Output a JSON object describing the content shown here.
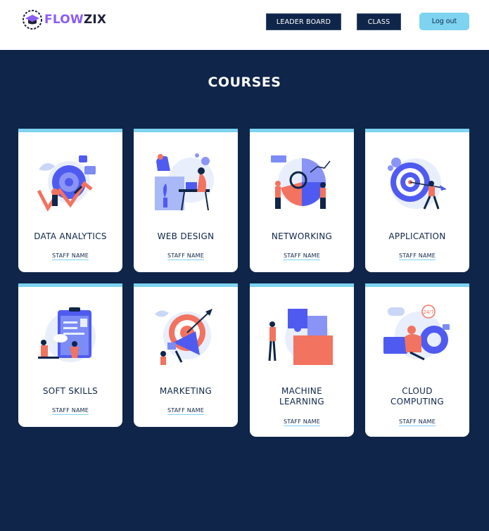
{
  "header": {
    "logo_part1": "FLOW",
    "logo_part2": "ZIX",
    "leaderboard_label": "LEADER BOARD",
    "class_label": "CLASS",
    "logout_label": "Log out"
  },
  "main": {
    "title": "COURSES",
    "courses": [
      {
        "name": "DATA ANALYTICS",
        "staff": "STAFF NAME"
      },
      {
        "name": "WEB DESIGN",
        "staff": "STAFF NAME"
      },
      {
        "name": "NETWORKING",
        "staff": "STAFF NAME"
      },
      {
        "name": "APPLICATION",
        "staff": "STAFF NAME"
      },
      {
        "name": "SOFT SKILLS",
        "staff": "STAFF NAME"
      },
      {
        "name": "MARKETING",
        "staff": "STAFF NAME"
      },
      {
        "name": "MACHINE\nLEARNING",
        "staff": "STAFF NAME"
      },
      {
        "name": "CLOUD\nCOMPUTING",
        "staff": "STAFF NAME"
      }
    ]
  },
  "colors": {
    "navy": "#0f2549",
    "accent": "#7dd3f0",
    "logo_purple": "#8b5cf6",
    "illustration_blue": "#4f5bf0",
    "illustration_coral": "#f2735f"
  }
}
